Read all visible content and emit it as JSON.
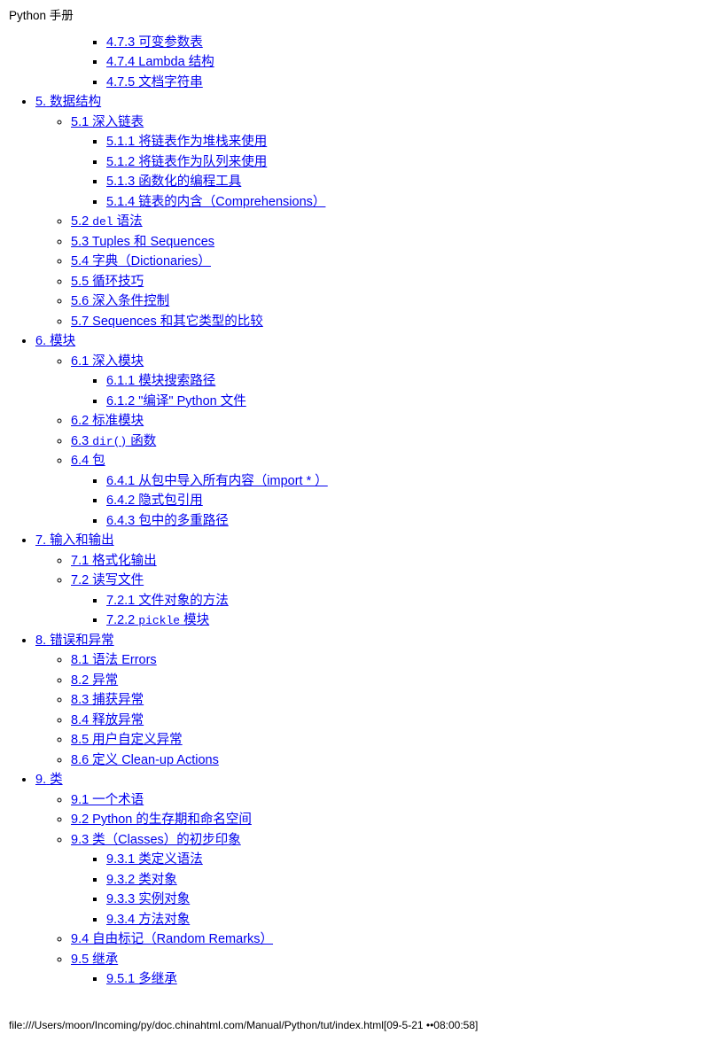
{
  "title": "Python 手册",
  "toc": {
    "ch4_items": [
      {
        "num": "4.7.3",
        "label": "可变参数表"
      },
      {
        "num": "4.7.4",
        "label": "Lambda 结构"
      },
      {
        "num": "4.7.5",
        "label": "文档字符串"
      }
    ],
    "ch5": {
      "num": "5.",
      "label": "数据结构"
    },
    "ch5_sections": [
      {
        "num": "5.1",
        "label": "深入链表",
        "children": [
          {
            "num": "5.1.1",
            "label": "将链表作为堆栈来使用"
          },
          {
            "num": "5.1.2",
            "label": "将链表作为队列来使用"
          },
          {
            "num": "5.1.3",
            "label": "函数化的编程工具"
          },
          {
            "num": "5.1.4",
            "label": "链表的内含（Comprehensions）"
          }
        ]
      },
      {
        "num": "5.2",
        "label": "语法",
        "code": "del"
      },
      {
        "num": "5.3",
        "label": "Tuples 和 Sequences"
      },
      {
        "num": "5.4",
        "label": "字典（Dictionaries）"
      },
      {
        "num": "5.5",
        "label": "循环技巧"
      },
      {
        "num": "5.6",
        "label": "深入条件控制"
      },
      {
        "num": "5.7",
        "label": "Sequences 和其它类型的比较"
      }
    ],
    "ch6": {
      "num": "6.",
      "label": "模块"
    },
    "ch6_sections": [
      {
        "num": "6.1",
        "label": "深入模块",
        "children": [
          {
            "num": "6.1.1",
            "label": "模块搜索路径"
          },
          {
            "num": "6.1.2",
            "label": "\"编译\" Python 文件"
          }
        ]
      },
      {
        "num": "6.2",
        "label": "标准模块"
      },
      {
        "num": "6.3",
        "label": "函数",
        "code": "dir()"
      },
      {
        "num": "6.4",
        "label": "包",
        "children": [
          {
            "num": "6.4.1",
            "label": "从包中导入所有内容（import * ）"
          },
          {
            "num": "6.4.2",
            "label": "隐式包引用"
          },
          {
            "num": "6.4.3",
            "label": "包中的多重路径"
          }
        ]
      }
    ],
    "ch7": {
      "num": "7.",
      "label": "输入和输出"
    },
    "ch7_sections": [
      {
        "num": "7.1",
        "label": "格式化输出"
      },
      {
        "num": "7.2",
        "label": "读写文件",
        "children": [
          {
            "num": "7.2.1",
            "label": "文件对象的方法"
          },
          {
            "num": "7.2.2",
            "label": "模块",
            "code": "pickle"
          }
        ]
      }
    ],
    "ch8": {
      "num": "8.",
      "label": "错误和异常"
    },
    "ch8_sections": [
      {
        "num": "8.1",
        "label": "语法 Errors"
      },
      {
        "num": "8.2",
        "label": "异常"
      },
      {
        "num": "8.3",
        "label": "捕获异常"
      },
      {
        "num": "8.4",
        "label": "释放异常"
      },
      {
        "num": "8.5",
        "label": "用户自定义异常"
      },
      {
        "num": "8.6",
        "label": "定义 Clean-up Actions"
      }
    ],
    "ch9": {
      "num": "9.",
      "label": "类"
    },
    "ch9_sections": [
      {
        "num": "9.1",
        "label": "一个术语"
      },
      {
        "num": "9.2",
        "label": "Python 的生存期和命名空间"
      },
      {
        "num": "9.3",
        "label": "类（Classes）的初步印象",
        "children": [
          {
            "num": "9.3.1",
            "label": "类定义语法"
          },
          {
            "num": "9.3.2",
            "label": "类对象"
          },
          {
            "num": "9.3.3",
            "label": "实例对象"
          },
          {
            "num": "9.3.4",
            "label": "方法对象"
          }
        ]
      },
      {
        "num": "9.4",
        "label": "自由标记（Random Remarks）"
      },
      {
        "num": "9.5",
        "label": "继承",
        "children": [
          {
            "num": "9.5.1",
            "label": "多继承"
          }
        ]
      }
    ]
  },
  "footer": "file:///Users/moon/Incoming/py/doc.chinahtml.com/Manual/Python/tut/index.html[09-5-21 ••08:00:58]"
}
